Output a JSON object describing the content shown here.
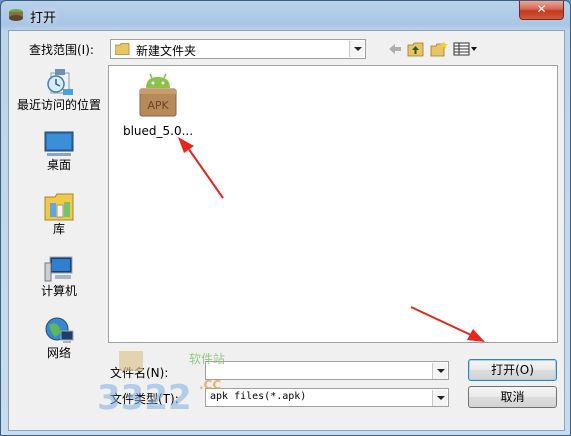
{
  "window": {
    "title": "打开",
    "close_glyph": "✕"
  },
  "toolbar": {
    "look_in_label": "查找范围(I):",
    "look_in_value": "新建文件夹",
    "buttons": [
      "back-icon",
      "up-folder-icon",
      "new-folder-icon",
      "view-menu-icon"
    ]
  },
  "places": [
    {
      "label": "最近访问的位置",
      "icon": "recent-places-icon"
    },
    {
      "label": "桌面",
      "icon": "desktop-icon"
    },
    {
      "label": "库",
      "icon": "libraries-icon"
    },
    {
      "label": "计算机",
      "icon": "computer-icon"
    },
    {
      "label": "网络",
      "icon": "network-icon"
    }
  ],
  "files": [
    {
      "name": "blued_5.0...",
      "icon": "apk-file-icon",
      "icon_text": "APK"
    }
  ],
  "filename": {
    "label": "文件名(N):",
    "value": ""
  },
  "filetype": {
    "label": "文件类型(T):",
    "value": "apk files(*.apk)"
  },
  "buttons": {
    "open": "打开(O)",
    "cancel": "取消"
  },
  "watermark": {
    "text": "软件站",
    "domain": ".CC",
    "number": "3322"
  },
  "colors": {
    "annotation_arrow": "#e8261f",
    "title_bar": "#a9c6e4",
    "close_button": "#c1391e"
  }
}
